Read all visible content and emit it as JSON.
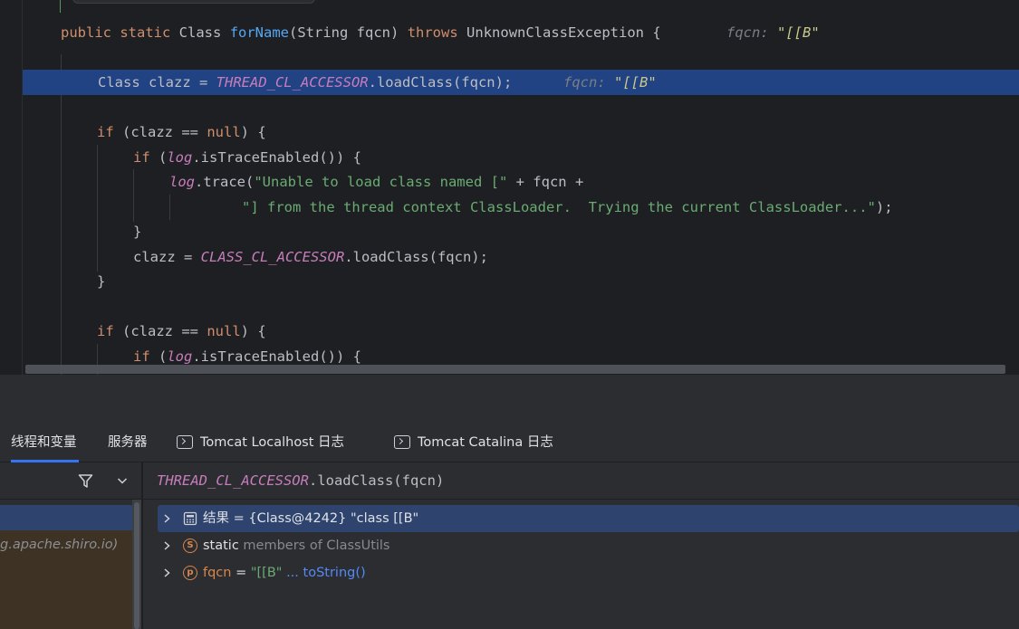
{
  "editor": {
    "signature": {
      "kw1": "public static",
      "cls": "Class",
      "method": "forName",
      "params": "(String fqcn)",
      "throws_kw": "throws",
      "exc": "UnknownClassException {",
      "hint_name": "fqcn:",
      "hint_value": "\"[[B\""
    },
    "line_current": {
      "pre": "Class clazz = ",
      "accessor": "THREAD_CL_ACCESSOR",
      "post": ".loadClass(fqcn);",
      "hint_name": "fqcn:",
      "hint_value": "\"[[B\""
    },
    "if1": {
      "kw": "if",
      "rest1": " (clazz == ",
      "null": "null",
      "rest2": ") {"
    },
    "if2": {
      "kw": "if",
      "rest1": " (",
      "log": "log",
      "rest2": ".isTraceEnabled()) {"
    },
    "trace": {
      "log": "log",
      "call": ".trace(",
      "str": "\"Unable to load class named [\"",
      "rest": " + fqcn +"
    },
    "trace_cont": {
      "str": "\"] from the thread context ClassLoader.  Trying the current ClassLoader...\"",
      "rest": ");"
    },
    "close_inner": "}",
    "assign2": {
      "pre": "clazz = ",
      "accessor": "CLASS_CL_ACCESSOR",
      "post": ".loadClass(fqcn);"
    },
    "close_outer": "}",
    "if3": {
      "kw": "if",
      "rest1": " (clazz == ",
      "null": "null",
      "rest2": ") {"
    },
    "if4": {
      "kw": "if",
      "rest1": " (",
      "log": "log",
      "rest2": ".isTraceEnabled()) {"
    }
  },
  "tabs": [
    {
      "label": "线程和变量",
      "icon": ""
    },
    {
      "label": "服务器",
      "icon": ""
    },
    {
      "label": "Tomcat Localhost 日志",
      "icon": "console-icon"
    },
    {
      "label": "Tomcat Catalina 日志",
      "icon": "console-icon"
    }
  ],
  "frames": {
    "selected_frame_text": "g.apache.shiro.io)"
  },
  "evaluate": {
    "accessor": "THREAD_CL_ACCESSOR",
    "call": ".loadClass(fqcn)"
  },
  "variables": [
    {
      "name": "结果",
      "eq": " = ",
      "value": "{Class@4242} \"class [[B\"",
      "icon": "calculator-icon"
    },
    {
      "name": "static",
      "rest": " members of ClassUtils",
      "icon": "static-icon",
      "icon_letter": "S"
    },
    {
      "name": "fqcn",
      "eq": " = ",
      "value": "\"[[B\"",
      "link": "... toString()",
      "icon": "parameter-icon",
      "icon_letter": "p"
    }
  ],
  "colors": {
    "keyword": "#cf8e6d",
    "method": "#56a8f5",
    "static_field": "#c77dbb",
    "string": "#6aab73",
    "selection": "#214283",
    "accent": "#3574f0"
  }
}
